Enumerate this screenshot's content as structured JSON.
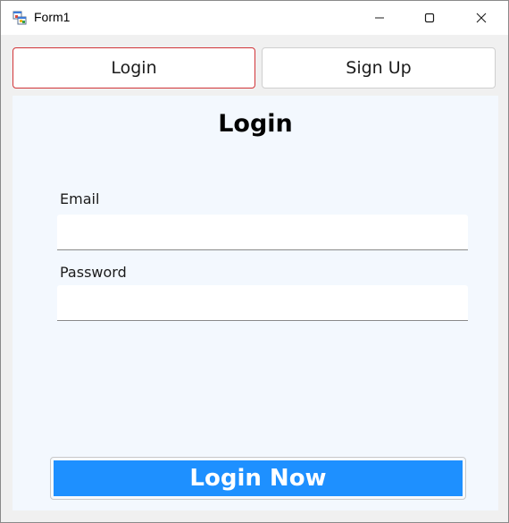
{
  "window": {
    "title": "Form1",
    "app_icon": "winforms-app-icon",
    "controls": {
      "minimize_icon": "minimize-icon",
      "maximize_icon": "maximize-icon",
      "close_icon": "close-icon"
    }
  },
  "tabs": [
    {
      "label": "Login",
      "selected": true
    },
    {
      "label": "Sign Up",
      "selected": false
    }
  ],
  "form": {
    "heading": "Login",
    "email": {
      "label": "Email",
      "value": ""
    },
    "password": {
      "label": "Password",
      "value": ""
    },
    "submit_label": "Login Now"
  },
  "colors": {
    "selected_tab_border": "#d13438",
    "panel_background": "#f3f8fe",
    "submit_background": "#1e90ff",
    "submit_text": "#ffffff"
  }
}
